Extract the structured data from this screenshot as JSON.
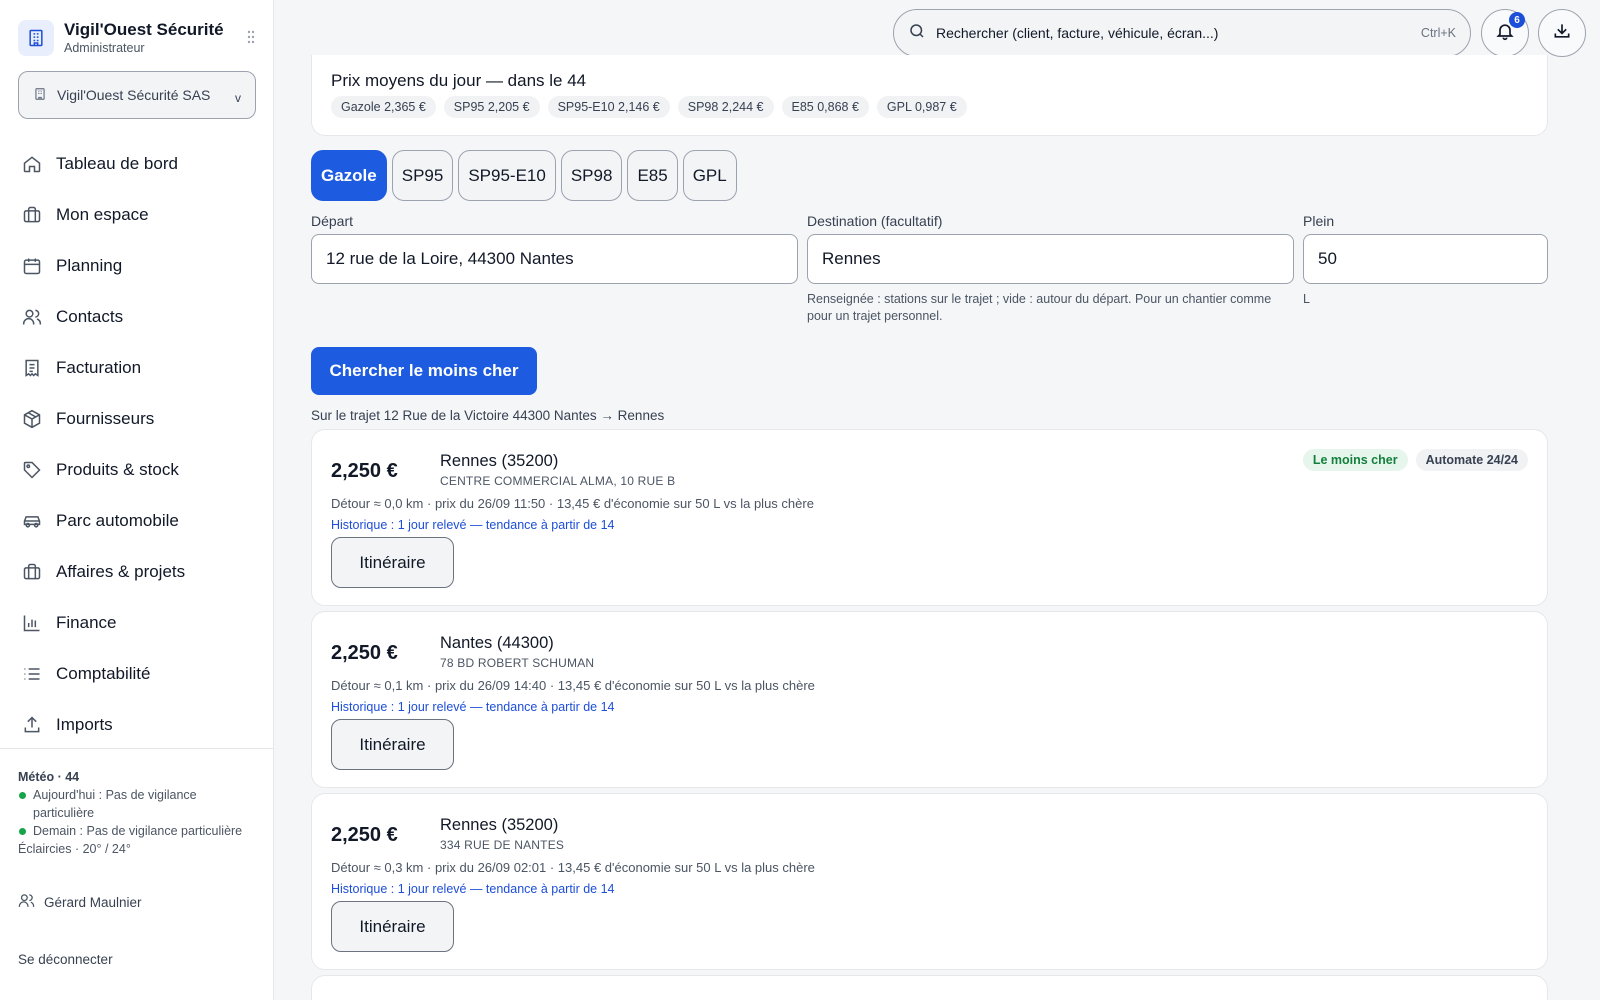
{
  "brand": {
    "name": "Vigil'Ouest Sécurité",
    "role": "Administrateur",
    "logo_icon": "building-icon"
  },
  "org_selector": {
    "value": "Vigil'Ouest Sécurité SAS",
    "chevron": "v"
  },
  "nav": [
    {
      "label": "Tableau de bord",
      "icon": "home-icon"
    },
    {
      "label": "Mon espace",
      "icon": "briefcase-icon"
    },
    {
      "label": "Planning",
      "icon": "calendar-icon"
    },
    {
      "label": "Contacts",
      "icon": "users-icon"
    },
    {
      "label": "Facturation",
      "icon": "receipt-icon"
    },
    {
      "label": "Fournisseurs",
      "icon": "package-icon"
    },
    {
      "label": "Produits & stock",
      "icon": "tag-icon"
    },
    {
      "label": "Parc automobile",
      "icon": "car-icon"
    },
    {
      "label": "Affaires & projets",
      "icon": "briefcase-icon"
    },
    {
      "label": "Finance",
      "icon": "bar-chart-icon"
    },
    {
      "label": "Comptabilité",
      "icon": "list-icon"
    },
    {
      "label": "Imports",
      "icon": "upload-icon"
    }
  ],
  "weather": {
    "title": "Météo · 44",
    "today": "Aujourd'hui : Pas de vigilance particulière",
    "tomorrow": "Demain : Pas de vigilance particulière",
    "forecast": "Éclaircies · 20° / 24°",
    "status_color": "#16a34a"
  },
  "user": {
    "name": "Gérard Maulnier"
  },
  "logout_label": "Se déconnecter",
  "search": {
    "placeholder": "Rechercher (client, facture, véhicule, écran...)",
    "shortcut": "Ctrl+K"
  },
  "notifications": {
    "count": "6"
  },
  "avg_prices": {
    "title": "Prix moyens du jour — dans le 44",
    "chips": [
      "Gazole 2,365 €",
      "SP95 2,205 €",
      "SP95-E10 2,146 €",
      "SP98 2,244 €",
      "E85 0,868 €",
      "GPL 0,987 €"
    ]
  },
  "fuel_tabs": [
    {
      "label": "Gazole",
      "active": true
    },
    {
      "label": "SP95",
      "active": false
    },
    {
      "label": "SP95-E10",
      "active": false
    },
    {
      "label": "SP98",
      "active": false
    },
    {
      "label": "E85",
      "active": false
    },
    {
      "label": "GPL",
      "active": false
    }
  ],
  "form": {
    "depart_label": "Départ",
    "depart_value": "12 rue de la Loire, 44300 Nantes",
    "destination_label": "Destination (facultatif)",
    "destination_value": "Rennes",
    "destination_hint": "Renseignée : stations sur le trajet ; vide : autour du départ. Pour un chantier comme pour un trajet personnel.",
    "plein_label": "Plein",
    "plein_value": "50",
    "plein_unit": "L"
  },
  "search_button": "Chercher le moins cher",
  "route_summary": "Sur le trajet 12 Rue de la Victoire 44300 Nantes → Rennes",
  "results": [
    {
      "price": "2,250 €",
      "city": "Rennes (35200)",
      "address": "CENTRE COMMERCIAL ALMA, 10 RUE B",
      "detail": "Détour ≈ 0,0 km · prix du 26/09 11:50 · 13,45 € d'économie sur 50 L vs la plus chère",
      "history": "Historique : 1 jour relevé — tendance à partir de 14",
      "button": "Itinéraire",
      "tag_cheapest": "Le moins cher",
      "tag_service": "Automate 24/24"
    },
    {
      "price": "2,250 €",
      "city": "Nantes (44300)",
      "address": "78 BD ROBERT SCHUMAN",
      "detail": "Détour ≈ 0,1 km · prix du 26/09 14:40 · 13,45 € d'économie sur 50 L vs la plus chère",
      "history": "Historique : 1 jour relevé — tendance à partir de 14",
      "button": "Itinéraire"
    },
    {
      "price": "2,250 €",
      "city": "Rennes (35200)",
      "address": "334 RUE DE NANTES",
      "detail": "Détour ≈ 0,3 km · prix du 26/09 02:01 · 13,45 € d'économie sur 50 L vs la plus chère",
      "history": "Historique : 1 jour relevé — tendance à partir de 14",
      "button": "Itinéraire"
    }
  ],
  "colors": {
    "accent": "#1d5be0",
    "link": "#1d4ed8",
    "tag_green_bg": "#e7f6ec",
    "tag_green_text": "#15803d"
  }
}
